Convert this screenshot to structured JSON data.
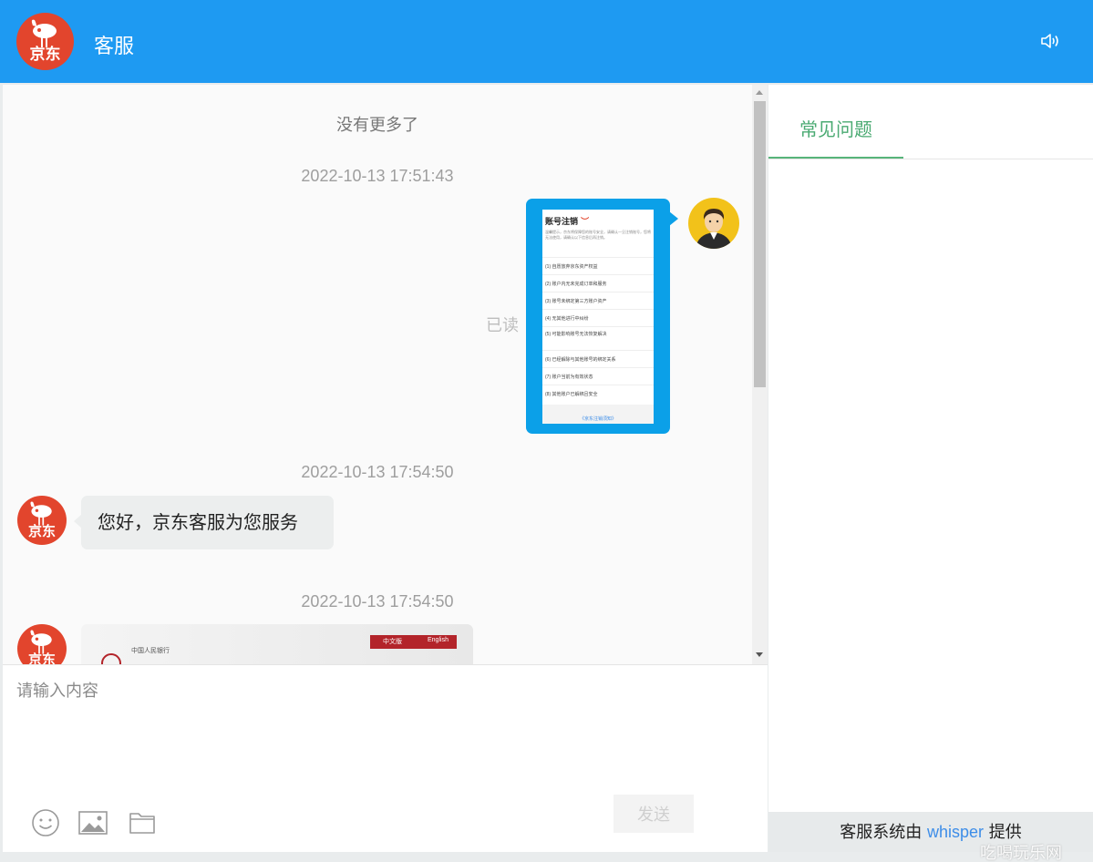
{
  "header": {
    "logo_text": "京东",
    "title": "客服",
    "sound_icon": "speaker-icon"
  },
  "chat": {
    "no_more": "没有更多了",
    "messages": [
      {
        "time": "2022-10-13 17:51:43",
        "sender": "user",
        "type": "image",
        "read_status": "已读",
        "doc": {
          "title": "账号注销",
          "intro": "温馨提示，京东将保障您的账号安全，请确认一旦注销账号，您将无法使用，请确认以下信息后再注销。",
          "items": [
            "(1) 自愿放弃京东资产权益",
            "(2) 账户内无未完成订单和服务",
            "(3) 账号未绑定第三方账户资产",
            "(4) 无其他进行中纠纷",
            "(5) 可能影响账号无法恢复解决",
            "(6) 已经解除与其他账号的绑定关系",
            "(7) 账户当前为有效状态",
            "(8) 其他账户已解绑且安全"
          ],
          "footer": "《京东注销须知》"
        }
      },
      {
        "time": "2022-10-13 17:54:50",
        "sender": "bot",
        "type": "text",
        "text": "您好，京东客服为您服务"
      },
      {
        "time": "2022-10-13 17:54:50",
        "sender": "bot",
        "type": "card",
        "card": {
          "org_label": "中国人民银行",
          "bar_label": "中文版",
          "bar_en": "English"
        }
      }
    ]
  },
  "input": {
    "placeholder": "请输入内容",
    "send_label": "发送",
    "tools": [
      "emoji-icon",
      "image-icon",
      "folder-icon"
    ]
  },
  "side": {
    "tab_label": "常见问题",
    "footer_prefix": "客服系统由",
    "footer_brand": "whisper",
    "footer_suffix": "提供"
  },
  "watermark": "吃喝玩乐网",
  "colors": {
    "header": "#1e9af2",
    "jd_red": "#e2452d",
    "image_bubble": "#0ba0e8",
    "tab_green": "#4aaa72"
  }
}
